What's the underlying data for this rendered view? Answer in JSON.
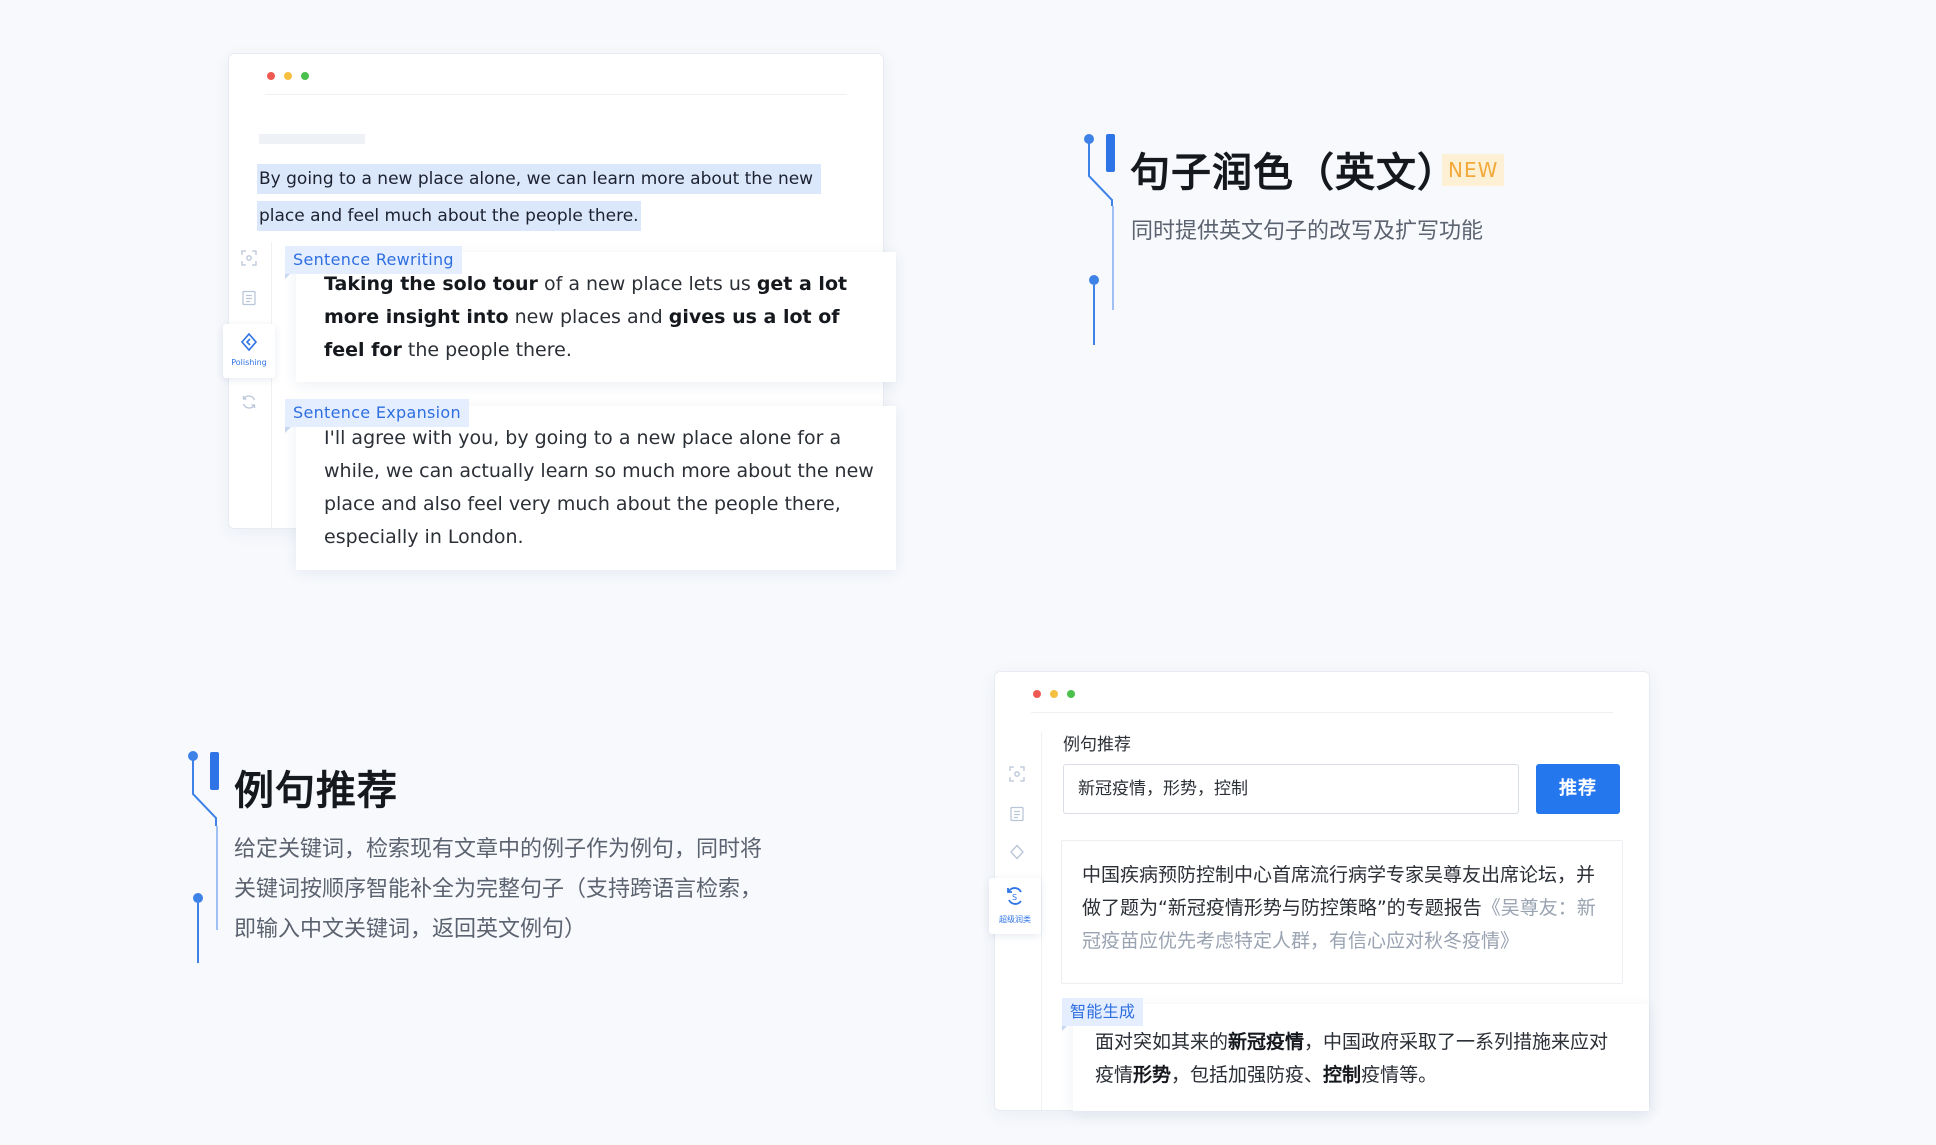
{
  "colors": {
    "accent": "#2e6fe0",
    "dot_red": "#ee5a52",
    "dot_yellow": "#f5bf3f",
    "dot_green": "#4cc04c",
    "badge_bg": "#fdf0d4",
    "badge_text": "#f2a93b"
  },
  "polishing_card": {
    "rail": {
      "icons": [
        "scan-icon",
        "document-icon",
        "diamond-icon",
        "refresh-icon"
      ],
      "active_label": "Polishing"
    },
    "source_lines": [
      "By going to a new place alone, we can learn more about the new",
      "place and feel much about the people there."
    ],
    "rewriting": {
      "tag": "Sentence Rewriting",
      "segments": [
        {
          "text": "Taking the solo tour",
          "bold": true
        },
        {
          "text": " of a new place lets us ",
          "bold": false
        },
        {
          "text": "get a lot more insight into",
          "bold": true
        },
        {
          "text": " new places and ",
          "bold": false
        },
        {
          "text": "gives us a lot of feel for",
          "bold": true
        },
        {
          "text": " the people there.",
          "bold": false
        }
      ]
    },
    "expansion": {
      "tag": "Sentence Expansion",
      "text": "I'll agree with you, by going to a new place alone for a while, we can actually learn so much more about the new place and also feel very much about the people there, especially in London."
    }
  },
  "feature_polish": {
    "title": "句子润色（英文）",
    "badge": "NEW",
    "description": "同时提供英文句子的改写及扩写功能"
  },
  "feature_examples": {
    "title": "例句推荐",
    "description_lines": [
      "给定关键词，检索现有文章中的例子作为例句，同时将",
      "关键词按顺序智能补全为完整句子（支持跨语言检索，",
      "即输入中文关键词，返回英文例句）"
    ]
  },
  "examples_card": {
    "rail": {
      "icons": [
        "scan-icon",
        "document-icon",
        "diamond-icon",
        "sync-s-icon"
      ],
      "active_label": "超级润类"
    },
    "section_label": "例句推荐",
    "input_value": "新冠疫情，形势，控制",
    "button_label": "推荐",
    "result": {
      "text": "中国疾病预防控制中心首席流行病学专家吴尊友出席论坛，并做了题为“新冠疫情形势与防控策略”的专题报告",
      "source": "《吴尊友：新冠疫苗应优先考虑特定人群，有信心应对秋冬疫情》"
    },
    "generated": {
      "tag": "智能生成",
      "segments": [
        {
          "text": "面对突如其来的",
          "bold": false
        },
        {
          "text": "新冠疫情",
          "bold": true
        },
        {
          "text": "，中国政府采取了一系列措施来应对疫情",
          "bold": false
        },
        {
          "text": "形势",
          "bold": true
        },
        {
          "text": "，包括加强防疫、",
          "bold": false
        },
        {
          "text": "控制",
          "bold": true
        },
        {
          "text": "疫情等。",
          "bold": false
        }
      ]
    }
  }
}
